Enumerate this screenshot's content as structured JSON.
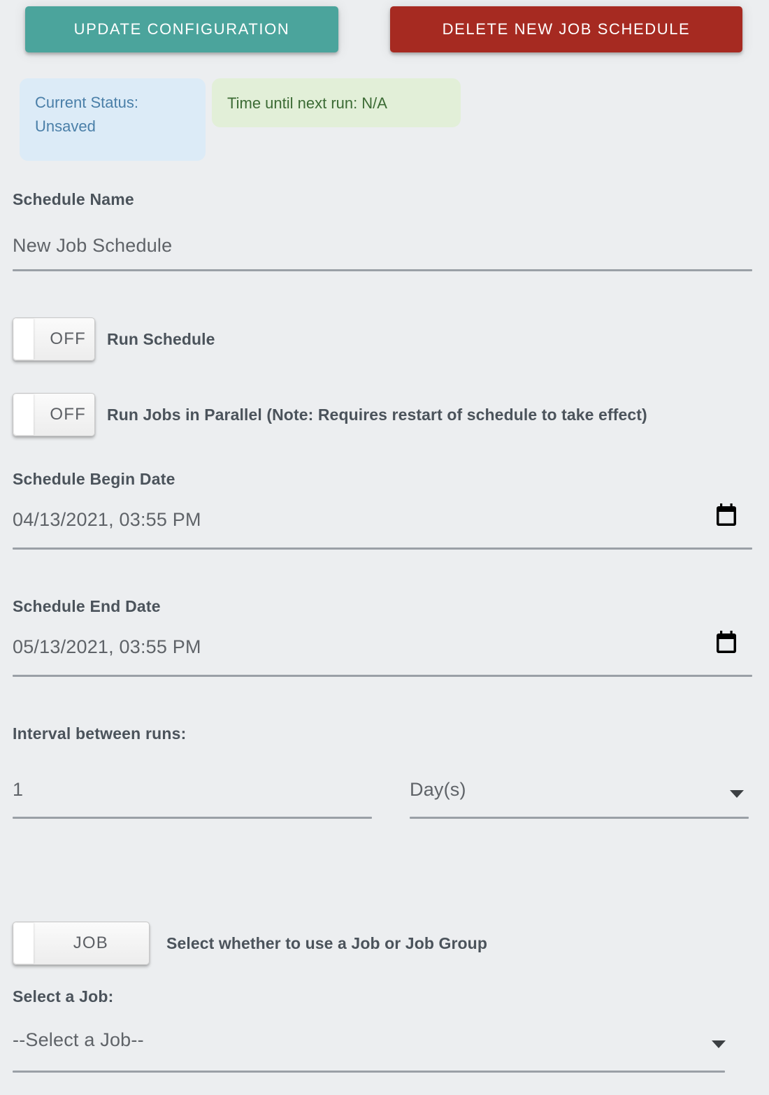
{
  "toolbar": {
    "update_label": "UPDATE CONFIGURATION",
    "delete_label": "DELETE NEW JOB SCHEDULE",
    "update_color": "#4ba49c",
    "delete_color": "#a62a21"
  },
  "status": {
    "current_status_label": "Current Status:",
    "current_status_value": "Unsaved",
    "current_status_bg": "#dcebf7",
    "current_status_fg": "#4a7fa8",
    "next_run_label": "Time until next run:",
    "next_run_value": "N/A",
    "next_run_bg": "#e2efd8",
    "next_run_fg": "#3c6b35"
  },
  "form": {
    "schedule_name": {
      "label": "Schedule Name",
      "value": "New Job Schedule"
    },
    "run_schedule": {
      "toggle_state": "OFF",
      "label": "Run Schedule"
    },
    "run_parallel": {
      "toggle_state": "OFF",
      "label": "Run Jobs in Parallel (Note: Requires restart of schedule to take effect)"
    },
    "begin_date": {
      "label": "Schedule Begin Date",
      "value": "04/13/2021, 03:55 PM"
    },
    "end_date": {
      "label": "Schedule End Date",
      "value": "05/13/2021, 03:55 PM"
    },
    "interval": {
      "label": "Interval between runs:",
      "amount": "1",
      "unit": "Day(s)"
    },
    "job_mode": {
      "toggle_state": "JOB",
      "label": "Select whether to use a Job or Job Group"
    },
    "job_select": {
      "label": "Select a Job:",
      "value": "--Select a Job--"
    }
  },
  "icons": {
    "calendar": "calendar-icon",
    "caret": "chevron-down-icon"
  }
}
